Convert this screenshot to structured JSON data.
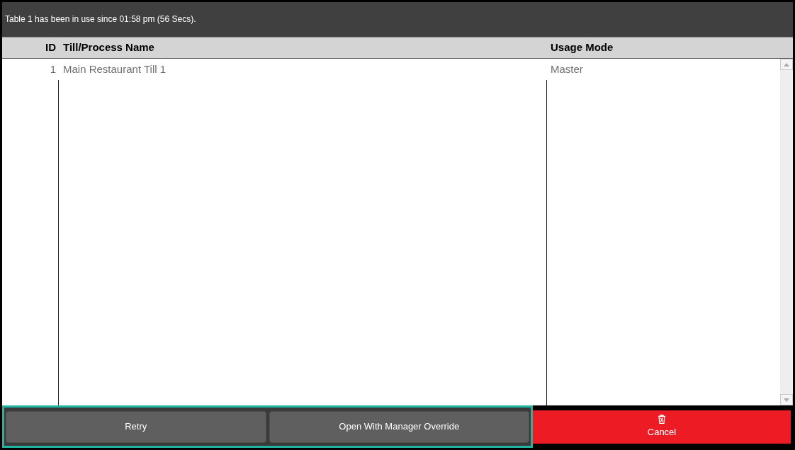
{
  "message": "Table 1 has been in use since 01:58 pm (56 Secs).",
  "table": {
    "columns": [
      "ID",
      "Till/Process Name",
      "Usage Mode"
    ],
    "rows": [
      [
        "1",
        "Main Restaurant Till 1",
        "Master"
      ]
    ]
  },
  "buttons": [
    {
      "label": "Retry",
      "kind": "neutral"
    },
    {
      "label": "Open With Manager Override",
      "kind": "neutral"
    },
    {
      "label": "Cancel",
      "kind": "danger"
    }
  ]
}
